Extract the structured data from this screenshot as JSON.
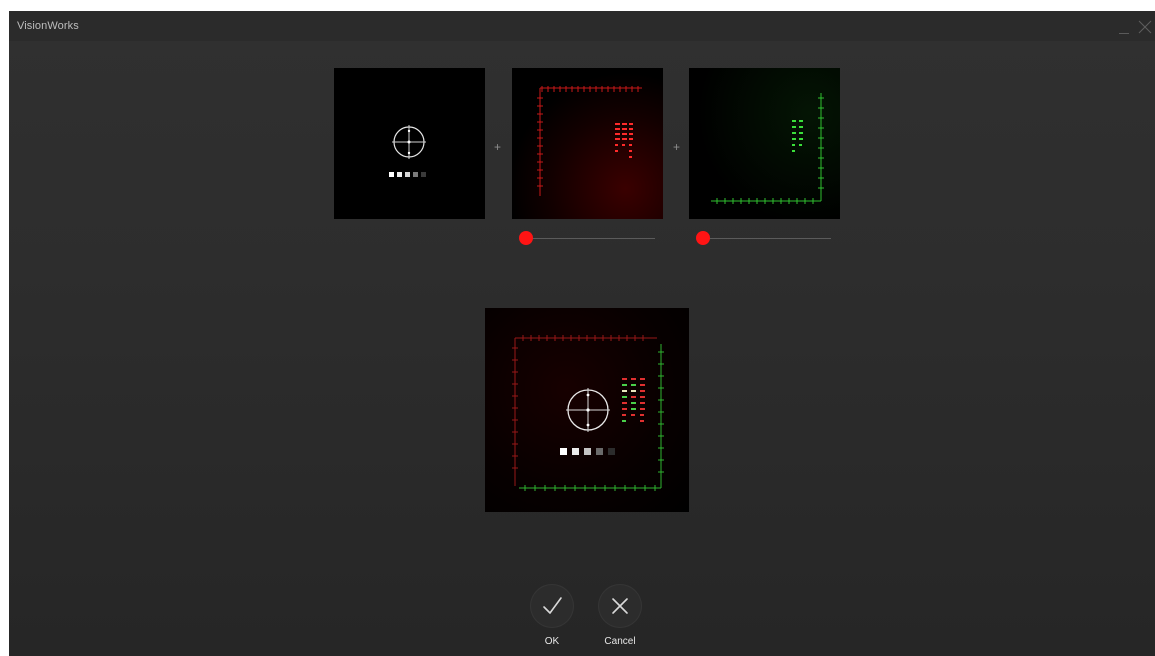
{
  "window": {
    "title": "VisionWorks"
  },
  "sources": {
    "panel_1": {
      "icon": "crosshair-target-icon"
    },
    "operator_1": "+",
    "panel_2": {
      "channel_color": "#ff1e1e",
      "slider_value": 0
    },
    "operator_2": "+",
    "panel_3": {
      "channel_color": "#22d02a",
      "slider_value": 0
    }
  },
  "result": {
    "description_icon": "composite-image"
  },
  "actions": {
    "ok_label": "OK",
    "cancel_label": "Cancel"
  },
  "colors": {
    "accent": "#ff1414",
    "background": "#2d2d2d"
  }
}
